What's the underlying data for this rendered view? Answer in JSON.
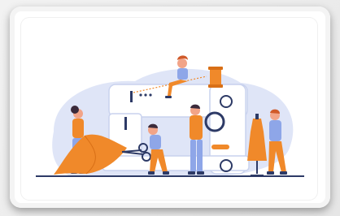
{
  "illustration": {
    "icon": "tailor-workshop-illustration",
    "colors": {
      "blob": "#dfe5f7",
      "machine": "#ffffff",
      "machine_outline": "#c9d2ee",
      "fabric": "#f0892a",
      "fabric_dark": "#d86f16",
      "navy": "#2d3a66",
      "skin": "#f2a488",
      "hair": "#3b2a3a",
      "pants_blue": "#8ea6e8",
      "floor": "#2d3a66"
    }
  }
}
